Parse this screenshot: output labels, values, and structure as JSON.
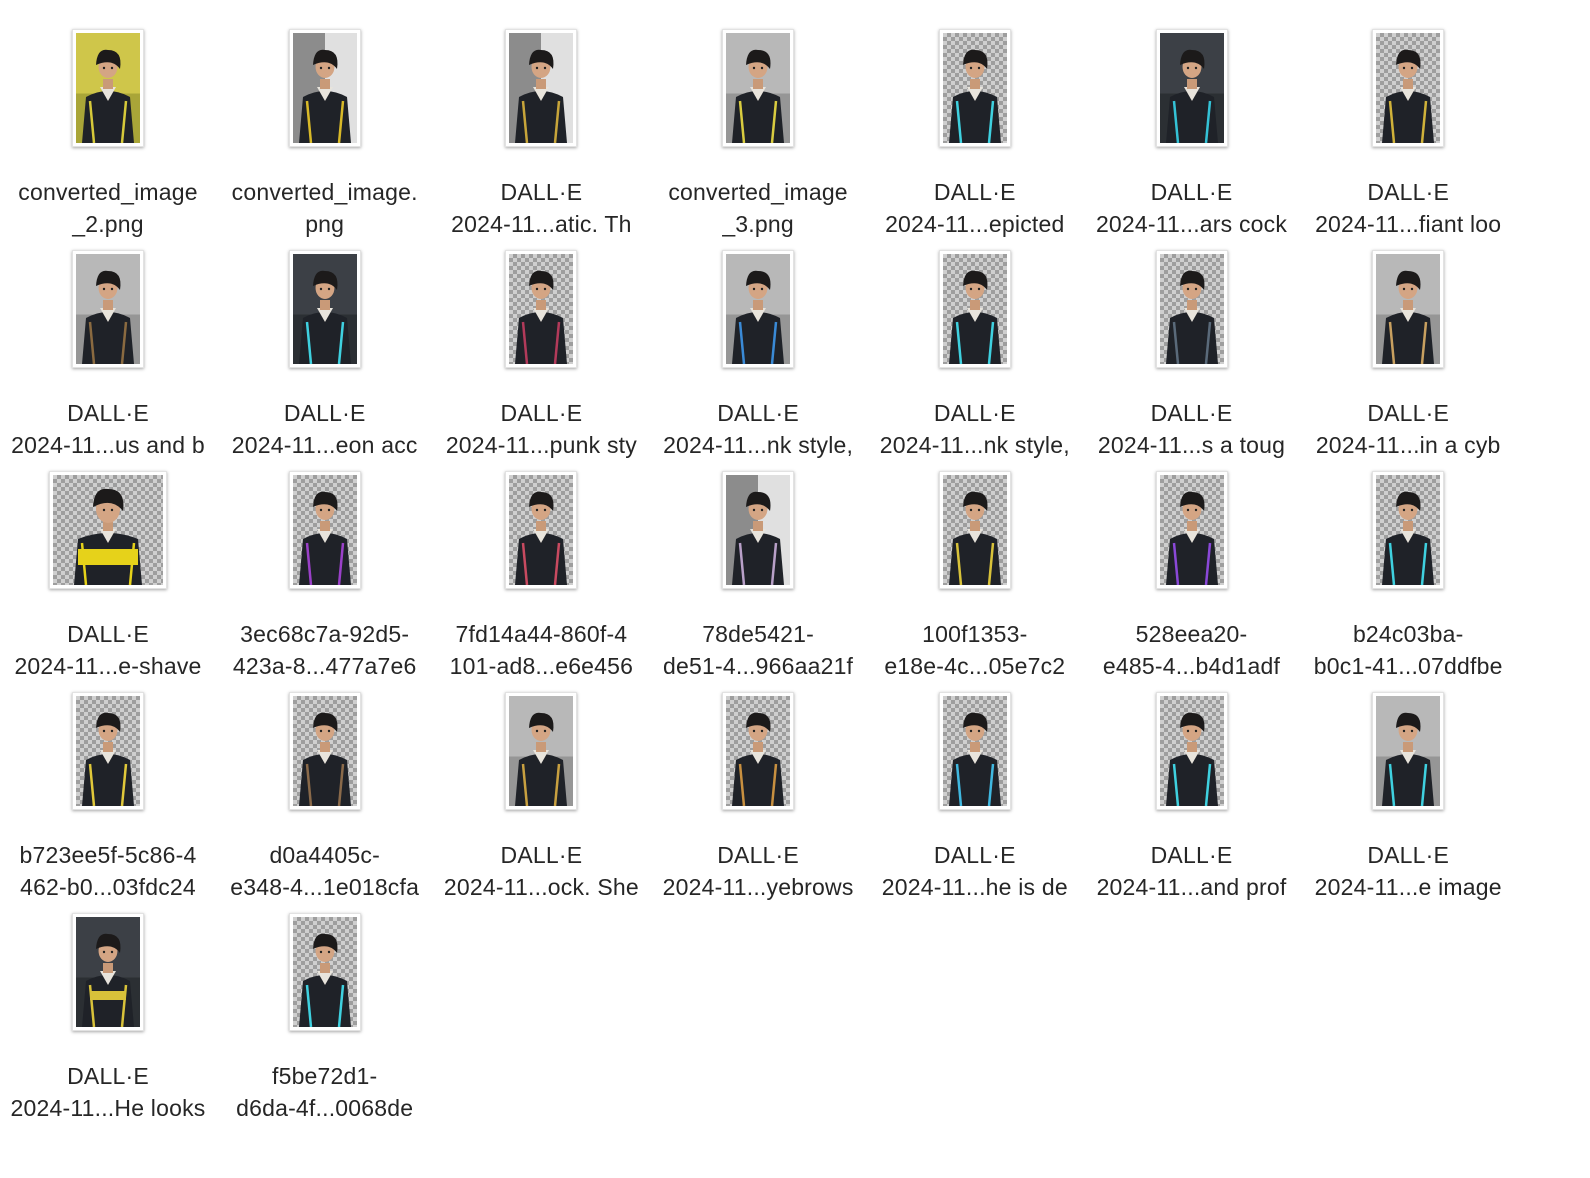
{
  "window": {
    "view": "icon-view",
    "content": "file-grid"
  },
  "files": [
    {
      "line1": "converted_image",
      "line2": "_2.png",
      "icon": "image-file-icon",
      "accent": "#d6c93a",
      "bg": "yellow",
      "shape": "tall"
    },
    {
      "line1": "converted_image.",
      "line2": "png",
      "icon": "image-file-icon",
      "accent": "#d8b928",
      "bg": "split",
      "shape": "tall"
    },
    {
      "line1": "DALL·E",
      "line2": "2024-11...atic. Th",
      "icon": "image-file-icon",
      "accent": "#c7a53a",
      "bg": "split",
      "shape": "tall"
    },
    {
      "line1": "converted_image",
      "line2": "_3.png",
      "icon": "image-file-icon",
      "accent": "#d9cc40",
      "bg": "grey",
      "shape": "tall"
    },
    {
      "line1": "DALL·E",
      "line2": "2024-11...epicted",
      "icon": "image-file-icon",
      "accent": "#3fd1e0",
      "bg": "checker",
      "shape": "tall"
    },
    {
      "line1": "DALL·E",
      "line2": "2024-11...ars cock",
      "icon": "image-file-icon",
      "accent": "#34c2d6",
      "bg": "dark",
      "shape": "tall"
    },
    {
      "line1": "DALL·E",
      "line2": "2024-11...fiant loo",
      "icon": "image-file-icon",
      "accent": "#d0b23a",
      "bg": "checker",
      "shape": "tall"
    },
    {
      "line1": "DALL·E",
      "line2": "2024-11...us and b",
      "icon": "image-file-icon",
      "accent": "#8a6a40",
      "bg": "grey",
      "shape": "tall"
    },
    {
      "line1": "DALL·E",
      "line2": "2024-11...eon acc",
      "icon": "image-file-icon",
      "accent": "#3fd1e0",
      "bg": "dark",
      "shape": "tall"
    },
    {
      "line1": "DALL·E",
      "line2": "2024-11...punk sty",
      "icon": "image-file-icon",
      "accent": "#b23a5a",
      "bg": "checker",
      "shape": "tall"
    },
    {
      "line1": "DALL·E",
      "line2": "2024-11...nk style,",
      "icon": "image-file-icon",
      "accent": "#3a8ad6",
      "bg": "grey",
      "shape": "tall"
    },
    {
      "line1": "DALL·E",
      "line2": "2024-11...nk style,",
      "icon": "image-file-icon",
      "accent": "#3fd1e0",
      "bg": "checker",
      "shape": "tall"
    },
    {
      "line1": "DALL·E",
      "line2": "2024-11...s a toug",
      "icon": "image-file-icon",
      "accent": "#5a6a7a",
      "bg": "checker",
      "shape": "tall"
    },
    {
      "line1": "DALL·E",
      "line2": "2024-11...in a cyb",
      "icon": "image-file-icon",
      "accent": "#c8a060",
      "bg": "grey",
      "shape": "tall"
    },
    {
      "line1": "DALL·E",
      "line2": "2024-11...e-shave",
      "icon": "image-file-icon",
      "accent": "#e6d21a",
      "bg": "checker",
      "shape": "wide",
      "badge": "SURVIVE"
    },
    {
      "line1": "3ec68c7a-92d5-",
      "line2": "423a-8...477a7e6",
      "icon": "image-file-icon",
      "accent": "#9a40c8",
      "bg": "checker",
      "shape": "tall"
    },
    {
      "line1": "7fd14a44-860f-4",
      "line2": "101-ad8...e6e456",
      "icon": "image-file-icon",
      "accent": "#c84a60",
      "bg": "checker",
      "shape": "tall"
    },
    {
      "line1": "78de5421-",
      "line2": "de51-4...966aa21f",
      "icon": "image-file-icon",
      "accent": "#b8a0c8",
      "bg": "split",
      "shape": "tall"
    },
    {
      "line1": "100f1353-",
      "line2": "e18e-4c...05e7c2",
      "icon": "image-file-icon",
      "accent": "#d8c23a",
      "bg": "checker",
      "shape": "tall"
    },
    {
      "line1": "528eea20-",
      "line2": "e485-4...b4d1adf",
      "icon": "image-file-icon",
      "accent": "#8a48d8",
      "bg": "checker",
      "shape": "tall"
    },
    {
      "line1": "b24c03ba-",
      "line2": "b0c1-41...07ddfbe",
      "icon": "image-file-icon",
      "accent": "#3fd1e0",
      "bg": "checker",
      "shape": "tall"
    },
    {
      "line1": "b723ee5f-5c86-4",
      "line2": "462-b0...03fdc24",
      "icon": "image-file-icon",
      "accent": "#e0c83a",
      "bg": "checker",
      "shape": "tall"
    },
    {
      "line1": "d0a4405c-",
      "line2": "e348-4...1e018cfa",
      "icon": "image-file-icon",
      "accent": "#8a6a4a",
      "bg": "checker",
      "shape": "tall"
    },
    {
      "line1": "DALL·E",
      "line2": "2024-11...ock. She",
      "icon": "image-file-icon",
      "accent": "#c8a040",
      "bg": "grey",
      "shape": "tall"
    },
    {
      "line1": "DALL·E",
      "line2": "2024-11...yebrows",
      "icon": "image-file-icon",
      "accent": "#c89040",
      "bg": "checker",
      "shape": "tall"
    },
    {
      "line1": "DALL·E",
      "line2": "2024-11...he is de",
      "icon": "image-file-icon",
      "accent": "#40b8e0",
      "bg": "checker",
      "shape": "tall"
    },
    {
      "line1": "DALL·E",
      "line2": "2024-11...and prof",
      "icon": "image-file-icon",
      "accent": "#3fd1e0",
      "bg": "checker",
      "shape": "tall"
    },
    {
      "line1": "DALL·E",
      "line2": "2024-11...e image",
      "icon": "image-file-icon",
      "accent": "#3fd1e0",
      "bg": "grey",
      "shape": "tall"
    },
    {
      "line1": "DALL·E",
      "line2": "2024-11...He looks",
      "icon": "image-file-icon",
      "accent": "#d8c23a",
      "bg": "dark",
      "shape": "tall",
      "badge": "SECURITY"
    },
    {
      "line1": "f5be72d1-",
      "line2": "d6da-4f...0068de",
      "icon": "image-file-icon",
      "accent": "#3fd1e0",
      "bg": "checker",
      "shape": "tall"
    }
  ]
}
